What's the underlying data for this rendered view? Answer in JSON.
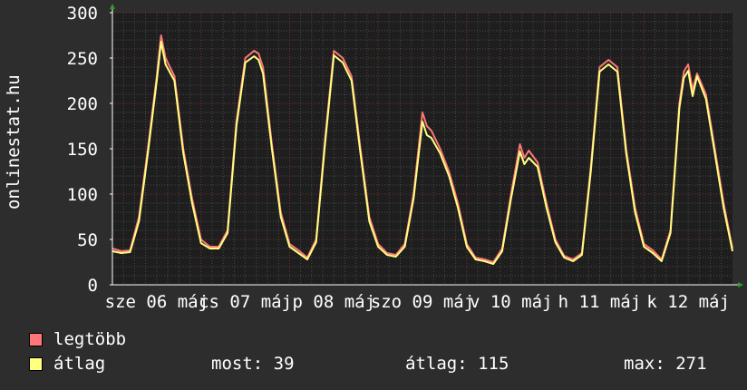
{
  "chart_data": {
    "type": "line",
    "ylabel": "onlinestat.hu",
    "ylim": [
      0,
      300
    ],
    "yticks": [
      0,
      50,
      100,
      150,
      200,
      250,
      300
    ],
    "grid": true,
    "x_tick_labels": [
      {
        "label": "sze 06 máj",
        "day_center": 0.5
      },
      {
        "label": "cs 07 máj",
        "day_center": 1.5
      },
      {
        "label": "p 08 máj",
        "day_center": 2.5
      },
      {
        "label": "szo 09 máj",
        "day_center": 3.5
      },
      {
        "label": "v 10 máj",
        "day_center": 4.5
      },
      {
        "label": "h 11 máj",
        "day_center": 5.5
      },
      {
        "label": "k 12 máj",
        "day_center": 6.5
      }
    ],
    "x_days": [
      0,
      7
    ],
    "series": [
      {
        "name": "legtöbb",
        "color": "#ff7777",
        "points": [
          [
            0.0,
            40
          ],
          [
            0.1,
            37
          ],
          [
            0.2,
            38
          ],
          [
            0.3,
            75
          ],
          [
            0.4,
            150
          ],
          [
            0.5,
            230
          ],
          [
            0.55,
            275
          ],
          [
            0.6,
            250
          ],
          [
            0.7,
            230
          ],
          [
            0.8,
            150
          ],
          [
            0.9,
            95
          ],
          [
            1.0,
            50
          ],
          [
            1.1,
            42
          ],
          [
            1.2,
            42
          ],
          [
            1.3,
            60
          ],
          [
            1.4,
            180
          ],
          [
            1.5,
            250
          ],
          [
            1.6,
            258
          ],
          [
            1.65,
            255
          ],
          [
            1.7,
            240
          ],
          [
            1.8,
            155
          ],
          [
            1.9,
            80
          ],
          [
            2.0,
            45
          ],
          [
            2.1,
            38
          ],
          [
            2.2,
            30
          ],
          [
            2.3,
            50
          ],
          [
            2.4,
            160
          ],
          [
            2.5,
            258
          ],
          [
            2.6,
            250
          ],
          [
            2.7,
            230
          ],
          [
            2.8,
            150
          ],
          [
            2.9,
            75
          ],
          [
            3.0,
            45
          ],
          [
            3.1,
            35
          ],
          [
            3.2,
            33
          ],
          [
            3.3,
            45
          ],
          [
            3.4,
            100
          ],
          [
            3.5,
            190
          ],
          [
            3.55,
            175
          ],
          [
            3.6,
            170
          ],
          [
            3.7,
            150
          ],
          [
            3.8,
            125
          ],
          [
            3.9,
            90
          ],
          [
            4.0,
            45
          ],
          [
            4.1,
            30
          ],
          [
            4.2,
            28
          ],
          [
            4.3,
            25
          ],
          [
            4.4,
            40
          ],
          [
            4.5,
            100
          ],
          [
            4.6,
            155
          ],
          [
            4.65,
            140
          ],
          [
            4.7,
            148
          ],
          [
            4.8,
            135
          ],
          [
            4.9,
            90
          ],
          [
            5.0,
            50
          ],
          [
            5.1,
            32
          ],
          [
            5.2,
            28
          ],
          [
            5.3,
            35
          ],
          [
            5.4,
            130
          ],
          [
            5.5,
            240
          ],
          [
            5.6,
            248
          ],
          [
            5.7,
            240
          ],
          [
            5.8,
            150
          ],
          [
            5.9,
            85
          ],
          [
            6.0,
            45
          ],
          [
            6.1,
            38
          ],
          [
            6.2,
            28
          ],
          [
            6.3,
            60
          ],
          [
            6.4,
            200
          ],
          [
            6.45,
            235
          ],
          [
            6.5,
            243
          ],
          [
            6.55,
            215
          ],
          [
            6.6,
            233
          ],
          [
            6.7,
            210
          ],
          [
            6.8,
            150
          ],
          [
            6.9,
            90
          ],
          [
            7.0,
            40
          ]
        ]
      },
      {
        "name": "átlag",
        "color": "#ffff80",
        "points": [
          [
            0.0,
            37
          ],
          [
            0.1,
            35
          ],
          [
            0.2,
            36
          ],
          [
            0.3,
            70
          ],
          [
            0.4,
            145
          ],
          [
            0.5,
            225
          ],
          [
            0.55,
            268
          ],
          [
            0.6,
            243
          ],
          [
            0.7,
            225
          ],
          [
            0.8,
            145
          ],
          [
            0.9,
            90
          ],
          [
            1.0,
            46
          ],
          [
            1.1,
            40
          ],
          [
            1.2,
            40
          ],
          [
            1.3,
            57
          ],
          [
            1.4,
            175
          ],
          [
            1.5,
            245
          ],
          [
            1.6,
            252
          ],
          [
            1.65,
            248
          ],
          [
            1.7,
            233
          ],
          [
            1.8,
            150
          ],
          [
            1.9,
            75
          ],
          [
            2.0,
            42
          ],
          [
            2.1,
            35
          ],
          [
            2.2,
            28
          ],
          [
            2.3,
            47
          ],
          [
            2.4,
            155
          ],
          [
            2.5,
            253
          ],
          [
            2.6,
            245
          ],
          [
            2.7,
            225
          ],
          [
            2.8,
            145
          ],
          [
            2.9,
            70
          ],
          [
            3.0,
            42
          ],
          [
            3.1,
            33
          ],
          [
            3.2,
            31
          ],
          [
            3.3,
            42
          ],
          [
            3.4,
            95
          ],
          [
            3.5,
            180
          ],
          [
            3.55,
            165
          ],
          [
            3.6,
            162
          ],
          [
            3.7,
            145
          ],
          [
            3.8,
            120
          ],
          [
            3.9,
            85
          ],
          [
            4.0,
            42
          ],
          [
            4.1,
            28
          ],
          [
            4.2,
            26
          ],
          [
            4.3,
            23
          ],
          [
            4.4,
            37
          ],
          [
            4.5,
            95
          ],
          [
            4.6,
            147
          ],
          [
            4.65,
            133
          ],
          [
            4.7,
            140
          ],
          [
            4.8,
            130
          ],
          [
            4.9,
            85
          ],
          [
            5.0,
            47
          ],
          [
            5.1,
            30
          ],
          [
            5.2,
            26
          ],
          [
            5.3,
            33
          ],
          [
            5.4,
            125
          ],
          [
            5.5,
            235
          ],
          [
            5.6,
            243
          ],
          [
            5.7,
            235
          ],
          [
            5.8,
            145
          ],
          [
            5.9,
            80
          ],
          [
            6.0,
            42
          ],
          [
            6.1,
            35
          ],
          [
            6.2,
            26
          ],
          [
            6.3,
            57
          ],
          [
            6.4,
            195
          ],
          [
            6.45,
            228
          ],
          [
            6.5,
            236
          ],
          [
            6.55,
            208
          ],
          [
            6.6,
            230
          ],
          [
            6.7,
            205
          ],
          [
            6.8,
            145
          ],
          [
            6.9,
            85
          ],
          [
            7.0,
            37
          ]
        ]
      }
    ]
  },
  "legend": [
    {
      "label": "legtöbb",
      "color": "#ff7777"
    },
    {
      "label": "átlag",
      "color": "#ffff80"
    }
  ],
  "stats": {
    "most": "most: 39",
    "atlag": "átlag: 115",
    "max": "max: 271"
  }
}
